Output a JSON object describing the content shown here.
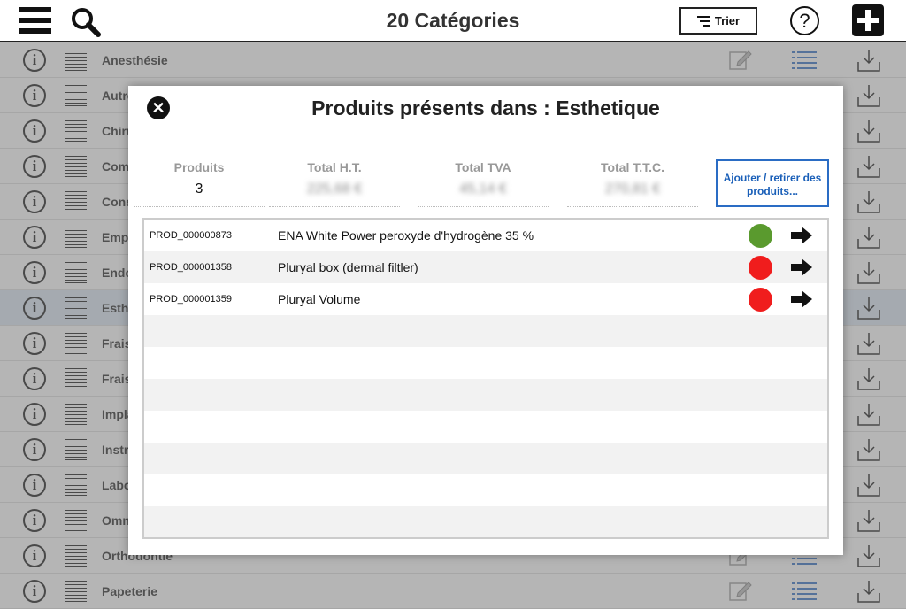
{
  "header": {
    "title": "20 Catégories",
    "sort_label": "Trier",
    "help_label": "?"
  },
  "categories": [
    {
      "name": "Anesthésie"
    },
    {
      "name": "Autres"
    },
    {
      "name": "Chirurgie"
    },
    {
      "name": "Composites"
    },
    {
      "name": "Consommables"
    },
    {
      "name": "Empreintes"
    },
    {
      "name": "Endodontie"
    },
    {
      "name": "Esthetique",
      "selected": true
    },
    {
      "name": "Fraises"
    },
    {
      "name": "Fraises"
    },
    {
      "name": "Implantologie"
    },
    {
      "name": "Instruments"
    },
    {
      "name": "Laboratoire"
    },
    {
      "name": "Omnipratique"
    },
    {
      "name": "Orthodontie"
    },
    {
      "name": "Papeterie"
    }
  ],
  "modal": {
    "title": "Produits présents dans : Esthetique",
    "close_icon": "close-icon",
    "stats": {
      "products_label": "Produits",
      "products_value": "3",
      "total_ht_label": "Total H.T.",
      "total_ht_value": "225,68 €",
      "total_tva_label": "Total TVA",
      "total_tva_value": "45,14 €",
      "total_ttc_label": "Total T.T.C.",
      "total_ttc_value": "270,81 €"
    },
    "add_remove_label": "Ajouter / retirer des produits...",
    "products": [
      {
        "code": "PROD_000000873",
        "name": "ENA White Power peroxyde d'hydrogène 35 %",
        "status_color": "#5a9a2e"
      },
      {
        "code": "PROD_000001358",
        "name": "Pluryal box (dermal filtler)",
        "status_color": "#f01d1d"
      },
      {
        "code": "PROD_000001359",
        "name": "Pluryal Volume",
        "status_color": "#f01d1d"
      }
    ],
    "empty_rows": 7
  },
  "colors": {
    "accent": "#2a6cc4",
    "selected_row": "#dbe6f3",
    "status_ok": "#5a9a2e",
    "status_alert": "#f01d1d"
  }
}
